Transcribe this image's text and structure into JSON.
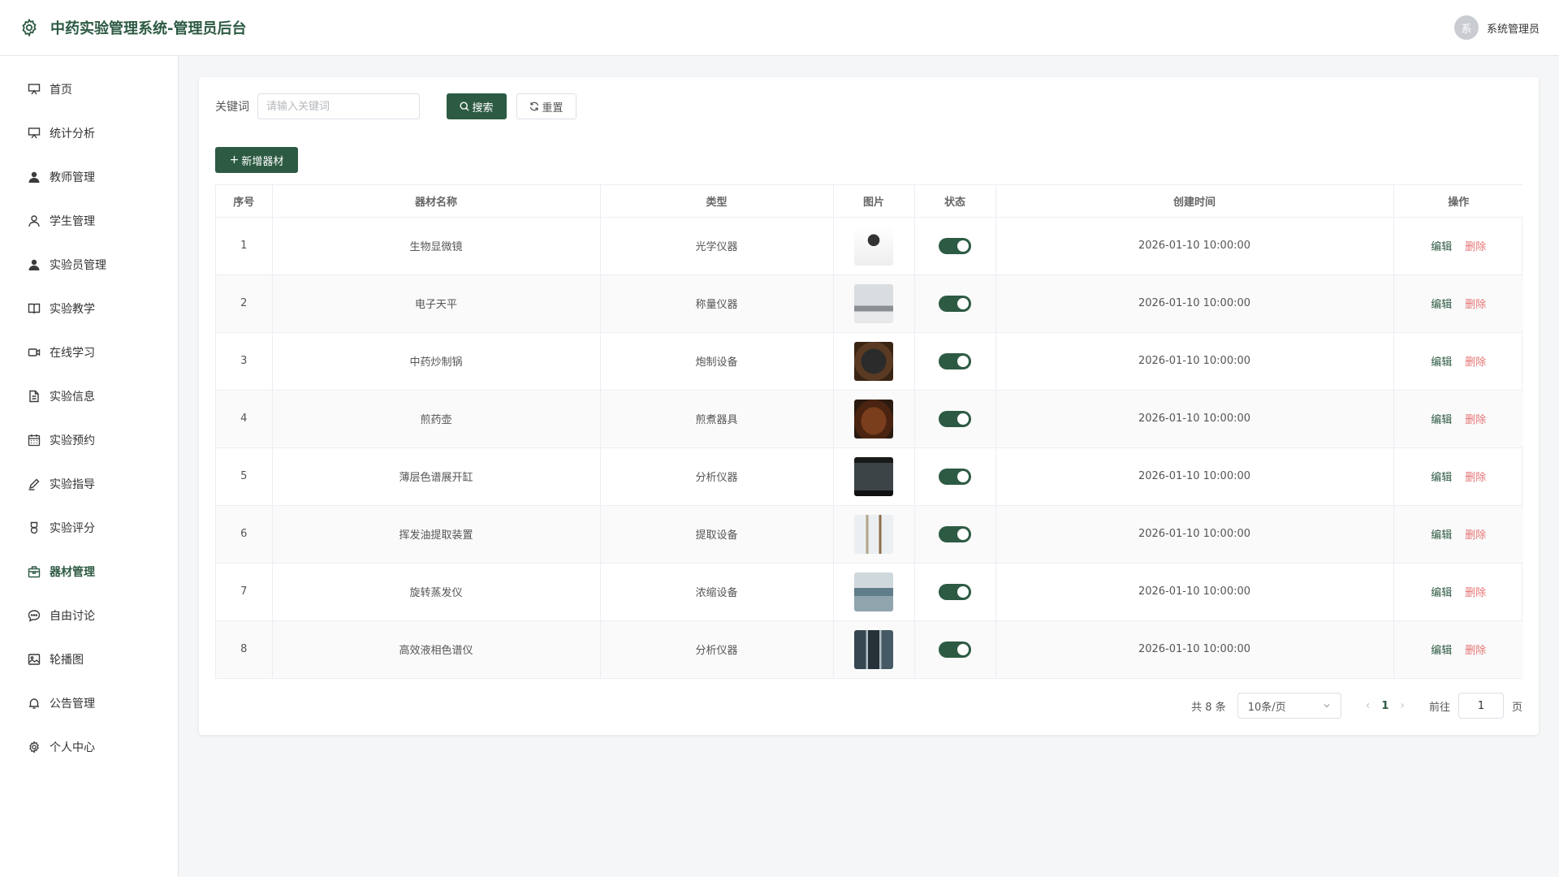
{
  "app": {
    "title": "中药实验管理系统-管理员后台",
    "user_avatar_text": "系",
    "user_name": "系统管理员"
  },
  "sidebar": {
    "items": [
      {
        "label": "首页",
        "icon": "presentation-icon"
      },
      {
        "label": "统计分析",
        "icon": "presentation-icon"
      },
      {
        "label": "教师管理",
        "icon": "user-filled-icon"
      },
      {
        "label": "学生管理",
        "icon": "user-icon"
      },
      {
        "label": "实验员管理",
        "icon": "user-filled-icon"
      },
      {
        "label": "实验教学",
        "icon": "book-icon"
      },
      {
        "label": "在线学习",
        "icon": "video-camera-icon"
      },
      {
        "label": "实验信息",
        "icon": "document-icon"
      },
      {
        "label": "实验预约",
        "icon": "calendar-icon"
      },
      {
        "label": "实验指导",
        "icon": "edit-pen-icon"
      },
      {
        "label": "实验评分",
        "icon": "medal-icon"
      },
      {
        "label": "器材管理",
        "icon": "box-icon",
        "active": true
      },
      {
        "label": "自由讨论",
        "icon": "chat-icon"
      },
      {
        "label": "轮播图",
        "icon": "picture-icon"
      },
      {
        "label": "公告管理",
        "icon": "bell-icon"
      },
      {
        "label": "个人中心",
        "icon": "gear-icon"
      }
    ]
  },
  "search": {
    "label": "关键词",
    "placeholder": "请输入关键词",
    "value": "",
    "search_button": "搜索",
    "reset_button": "重置"
  },
  "toolbar": {
    "add_button": "新增器材"
  },
  "table": {
    "headers": [
      "序号",
      "器材名称",
      "类型",
      "图片",
      "状态",
      "创建时间",
      "操作"
    ],
    "rows": [
      {
        "index": "1",
        "name": "生物显微镜",
        "type": "光学仪器",
        "status_on": true,
        "created": "2026-01-10 10:00:00"
      },
      {
        "index": "2",
        "name": "电子天平",
        "type": "称量仪器",
        "status_on": true,
        "created": "2026-01-10 10:00:00"
      },
      {
        "index": "3",
        "name": "中药炒制锅",
        "type": "炮制设备",
        "status_on": true,
        "created": "2026-01-10 10:00:00"
      },
      {
        "index": "4",
        "name": "煎药壶",
        "type": "煎煮器具",
        "status_on": true,
        "created": "2026-01-10 10:00:00"
      },
      {
        "index": "5",
        "name": "薄层色谱展开缸",
        "type": "分析仪器",
        "status_on": true,
        "created": "2026-01-10 10:00:00"
      },
      {
        "index": "6",
        "name": "挥发油提取装置",
        "type": "提取设备",
        "status_on": true,
        "created": "2026-01-10 10:00:00"
      },
      {
        "index": "7",
        "name": "旋转蒸发仪",
        "type": "浓缩设备",
        "status_on": true,
        "created": "2026-01-10 10:00:00"
      },
      {
        "index": "8",
        "name": "高效液相色谱仪",
        "type": "分析仪器",
        "status_on": true,
        "created": "2026-01-10 10:00:00"
      }
    ],
    "edit_label": "编辑",
    "delete_label": "删除"
  },
  "pagination": {
    "total_text": "共 8 条",
    "page_size": "10条/页",
    "current_page": "1",
    "goto_label": "前往",
    "goto_value": "1",
    "page_suffix": "页"
  },
  "colors": {
    "brand": "#2d5a43",
    "delete": "#e57373"
  }
}
